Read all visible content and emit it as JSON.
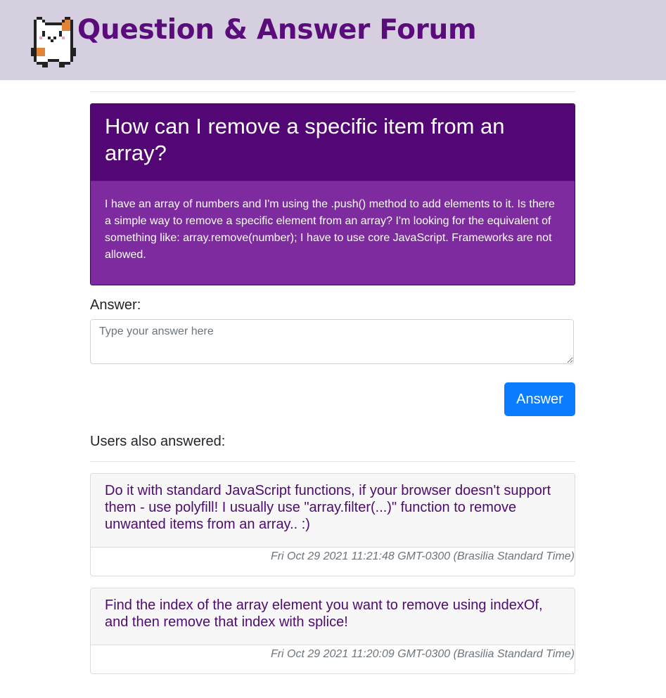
{
  "site": {
    "title": "Question & Answer Forum",
    "logo_icon": "pixel-cat-icon"
  },
  "question": {
    "title": "How can I remove a specific item from an array?",
    "body": "I have an array of numbers and I'm using the .push() method to add elements to it. Is there a simple way to remove a specific element from an array? I'm looking for the equivalent of something like: array.remove(number); I have to use core JavaScript. Frameworks are not allowed."
  },
  "answer_form": {
    "label": "Answer:",
    "placeholder": "Type your answer here",
    "value": "",
    "button_label": "Answer"
  },
  "answers": {
    "heading": "Users also answered:",
    "items": [
      {
        "text": "Do it with standard JavaScript functions, if your browser doesn't support them - use polyfill! I usually use \"array.filter(...)\" function to remove unwanted items from an array.. :)",
        "date": "Fri Oct 29 2021 11:21:48 GMT-0300 (Brasilia Standard Time)"
      },
      {
        "text": "Find the index of the array element you want to remove using indexOf, and then remove that index with splice!",
        "date": "Fri Oct 29 2021 11:20:09 GMT-0300 (Brasilia Standard Time)"
      }
    ]
  },
  "colors": {
    "header_bg": "#d6cfe0",
    "brand_purple": "#5a0c7a",
    "question_title_bg": "#520774",
    "question_body_bg": "#7d2b9f",
    "button_blue": "#0a7cff",
    "answer_text": "#4e0b6e"
  }
}
